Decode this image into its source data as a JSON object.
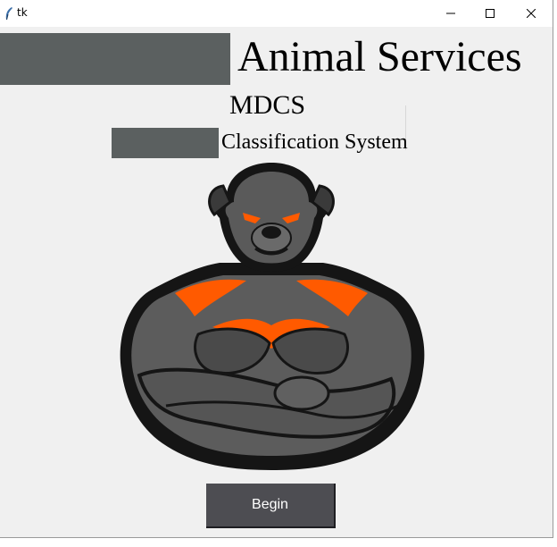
{
  "window": {
    "title": "tk",
    "controls": {
      "minimize": "minimize-icon",
      "maximize": "maximize-icon",
      "close": "close-icon"
    }
  },
  "header": {
    "title": "Animal Services",
    "subtitle": "MDCS",
    "tagline": "Classification System"
  },
  "mascot": {
    "icon": "muscular-dog-mascot",
    "accent_color": "#ff5a00",
    "body_color": "#5a5a5a"
  },
  "actions": {
    "begin_label": "Begin"
  },
  "colors": {
    "redaction": "#5b6060",
    "button_bg": "#4d4d52",
    "window_bg": "#f0f0f0"
  }
}
